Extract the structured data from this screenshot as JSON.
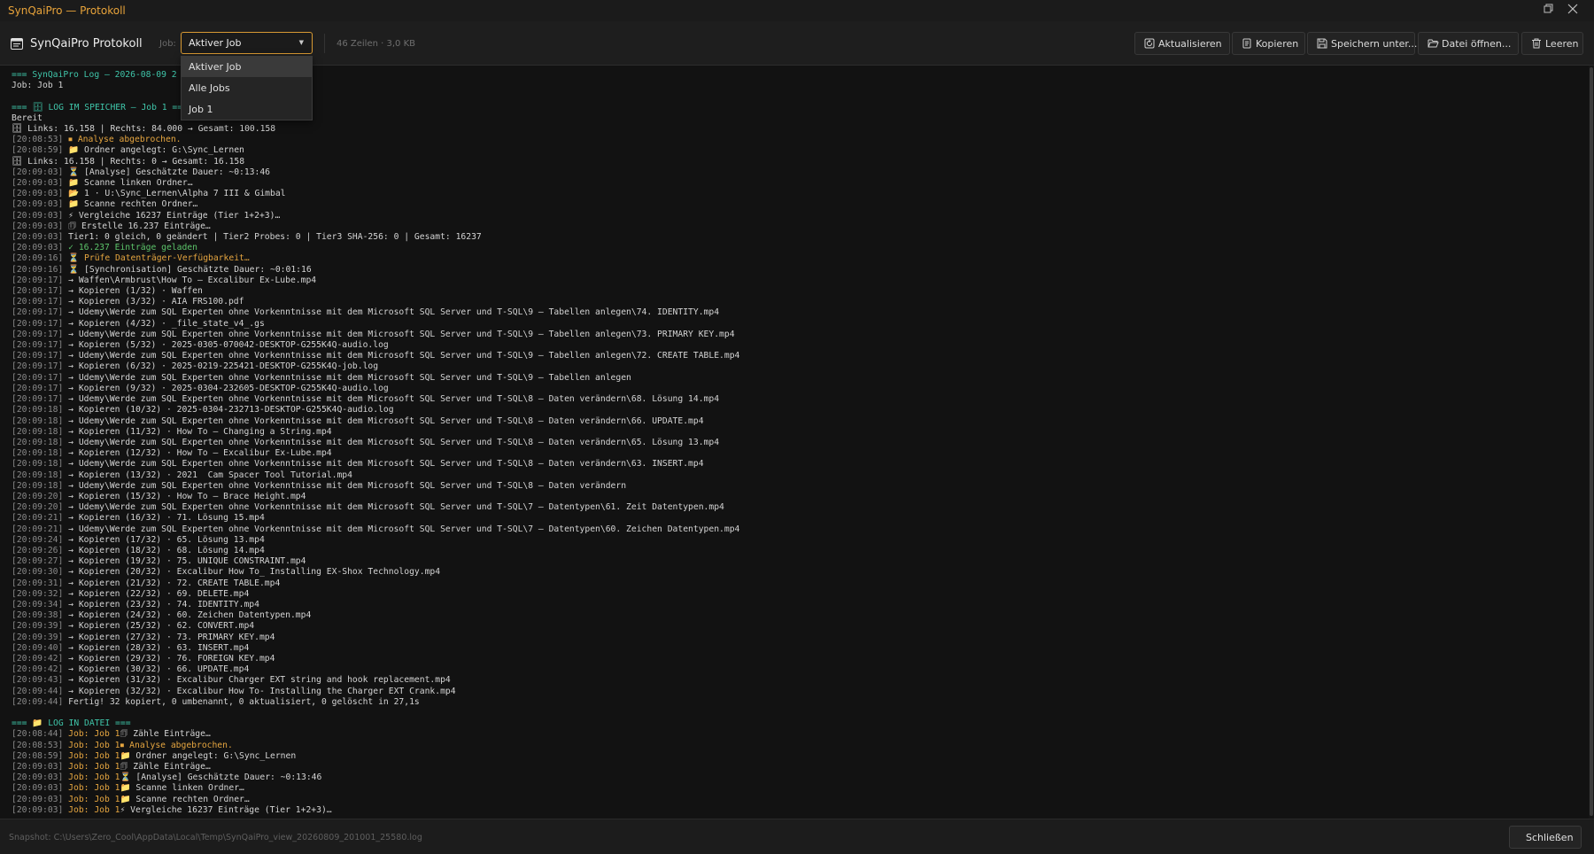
{
  "window": {
    "title": "SynQaiPro — Protokoll",
    "restore_icon": "restore-icon",
    "close_icon": "close-icon"
  },
  "toolbar": {
    "title": "SynQaiPro Protokoll",
    "job_label": "Job:",
    "job_selected": "Aktiver Job",
    "info": "46 Zeilen · 3,0 KB",
    "buttons": [
      {
        "label": "Aktualisieren",
        "icon": "refresh-icon"
      },
      {
        "label": "Kopieren",
        "icon": "copy-icon"
      },
      {
        "label": "Speichern unter...",
        "icon": "save-icon"
      },
      {
        "label": "Datei öffnen...",
        "icon": "folder-open-icon"
      },
      {
        "label": "Leeren",
        "icon": "trash-icon"
      }
    ]
  },
  "dropdown": {
    "options": [
      "Aktiver Job",
      "Alle Jobs",
      "Job 1"
    ],
    "selected_index": 0
  },
  "log": {
    "lines": [
      [
        [
          "=== SynQaiPro Log – 2026-08-09 2",
          "hd"
        ]
      ],
      [
        [
          "Job: Job 1",
          ""
        ]
      ],
      [
        [
          "",
          ""
        ]
      ],
      [
        [
          "=== 🗄 LOG IM SPEICHER – Job 1 ===",
          "hd"
        ]
      ],
      [
        [
          "Bereit",
          ""
        ]
      ],
      [
        [
          "🗄 Links: 16.158 | Rechts: 84.000 → Gesamt: 100.158",
          ""
        ]
      ],
      [
        [
          "[20:08:53] ",
          "ts"
        ],
        [
          "⏹ Analyse abgebrochen.",
          "wn"
        ]
      ],
      [
        [
          "[20:08:59] ",
          "ts"
        ],
        [
          "📁 Ordner angelegt: G:\\Sync_Lernen",
          ""
        ]
      ],
      [
        [
          "🗄 Links: 16.158 | Rechts: 0 → Gesamt: 16.158",
          ""
        ]
      ],
      [
        [
          "[20:09:03] ",
          "ts"
        ],
        [
          "⏳ [Analyse] Geschätzte Dauer: ~0:13:46",
          ""
        ]
      ],
      [
        [
          "[20:09:03] ",
          "ts"
        ],
        [
          "📁 Scanne linken Ordner…",
          ""
        ]
      ],
      [
        [
          "[20:09:03] ",
          "ts"
        ],
        [
          "📂 1 · U:\\Sync_Lernen\\Alpha 7 III & Gimbal",
          ""
        ]
      ],
      [
        [
          "[20:09:03] ",
          "ts"
        ],
        [
          "📁 Scanne rechten Ordner…",
          ""
        ]
      ],
      [
        [
          "[20:09:03] ",
          "ts"
        ],
        [
          "⚡ Vergleiche 16237 Einträge (Tier 1+2+3)…",
          ""
        ]
      ],
      [
        [
          "[20:09:03] ",
          "ts"
        ],
        [
          "🗊 Erstelle 16.237 Einträge…",
          ""
        ]
      ],
      [
        [
          "[20:09:03] ",
          "ts"
        ],
        [
          "Tier1: 0 gleich, 0 geändert | Tier2 Probes: 0 | Tier3 SHA-256: 0 | Gesamt: 16237",
          ""
        ]
      ],
      [
        [
          "[20:09:03] ",
          "ts"
        ],
        [
          "✓ 16.237 Einträge geladen",
          "ok"
        ]
      ],
      [
        [
          "[20:09:16] ",
          "ts"
        ],
        [
          "⏳ Prüfe Datenträger-Verfügbarkeit…",
          "wn"
        ]
      ],
      [
        [
          "[20:09:16] ",
          "ts"
        ],
        [
          "⏳ [Synchronisation] Geschätzte Dauer: ~0:01:16",
          ""
        ]
      ],
      [
        [
          "[20:09:17] ",
          "ts"
        ],
        [
          "→ Waffen\\Armbrust\\How To – Excalibur Ex-Lube.mp4",
          ""
        ]
      ],
      [
        [
          "[20:09:17] ",
          "ts"
        ],
        [
          "→ Kopieren (1/32) · Waffen",
          ""
        ]
      ],
      [
        [
          "[20:09:17] ",
          "ts"
        ],
        [
          "→ Kopieren (3/32) · AIA FRS100.pdf",
          ""
        ]
      ],
      [
        [
          "[20:09:17] ",
          "ts"
        ],
        [
          "→ Udemy\\Werde zum SQL Experten ohne Vorkenntnisse mit dem Microsoft SQL Server und T-SQL\\9 – Tabellen anlegen\\74. IDENTITY.mp4",
          ""
        ]
      ],
      [
        [
          "[20:09:17] ",
          "ts"
        ],
        [
          "→ Kopieren (4/32) · _file_state_v4_.gs",
          ""
        ]
      ],
      [
        [
          "[20:09:17] ",
          "ts"
        ],
        [
          "→ Udemy\\Werde zum SQL Experten ohne Vorkenntnisse mit dem Microsoft SQL Server und T-SQL\\9 – Tabellen anlegen\\73. PRIMARY KEY.mp4",
          ""
        ]
      ],
      [
        [
          "[20:09:17] ",
          "ts"
        ],
        [
          "→ Kopieren (5/32) · 2025-0305-070042-DESKTOP-G255K4Q-audio.log",
          ""
        ]
      ],
      [
        [
          "[20:09:17] ",
          "ts"
        ],
        [
          "→ Udemy\\Werde zum SQL Experten ohne Vorkenntnisse mit dem Microsoft SQL Server und T-SQL\\9 – Tabellen anlegen\\72. CREATE TABLE.mp4",
          ""
        ]
      ],
      [
        [
          "[20:09:17] ",
          "ts"
        ],
        [
          "→ Kopieren (6/32) · 2025-0219-225421-DESKTOP-G255K4Q-job.log",
          ""
        ]
      ],
      [
        [
          "[20:09:17] ",
          "ts"
        ],
        [
          "→ Udemy\\Werde zum SQL Experten ohne Vorkenntnisse mit dem Microsoft SQL Server und T-SQL\\9 – Tabellen anlegen",
          ""
        ]
      ],
      [
        [
          "[20:09:17] ",
          "ts"
        ],
        [
          "→ Kopieren (9/32) · 2025-0304-232605-DESKTOP-G255K4Q-audio.log",
          ""
        ]
      ],
      [
        [
          "[20:09:17] ",
          "ts"
        ],
        [
          "→ Udemy\\Werde zum SQL Experten ohne Vorkenntnisse mit dem Microsoft SQL Server und T-SQL\\8 – Daten verändern\\68. Lösung 14.mp4",
          ""
        ]
      ],
      [
        [
          "[20:09:18] ",
          "ts"
        ],
        [
          "→ Kopieren (10/32) · 2025-0304-232713-DESKTOP-G255K4Q-audio.log",
          ""
        ]
      ],
      [
        [
          "[20:09:18] ",
          "ts"
        ],
        [
          "→ Udemy\\Werde zum SQL Experten ohne Vorkenntnisse mit dem Microsoft SQL Server und T-SQL\\8 – Daten verändern\\66. UPDATE.mp4",
          ""
        ]
      ],
      [
        [
          "[20:09:18] ",
          "ts"
        ],
        [
          "→ Kopieren (11/32) · How To – Changing a String.mp4",
          ""
        ]
      ],
      [
        [
          "[20:09:18] ",
          "ts"
        ],
        [
          "→ Udemy\\Werde zum SQL Experten ohne Vorkenntnisse mit dem Microsoft SQL Server und T-SQL\\8 – Daten verändern\\65. Lösung 13.mp4",
          ""
        ]
      ],
      [
        [
          "[20:09:18] ",
          "ts"
        ],
        [
          "→ Kopieren (12/32) · How To – Excalibur Ex-Lube.mp4",
          ""
        ]
      ],
      [
        [
          "[20:09:18] ",
          "ts"
        ],
        [
          "→ Udemy\\Werde zum SQL Experten ohne Vorkenntnisse mit dem Microsoft SQL Server und T-SQL\\8 – Daten verändern\\63. INSERT.mp4",
          ""
        ]
      ],
      [
        [
          "[20:09:18] ",
          "ts"
        ],
        [
          "→ Kopieren (13/32) · 2021  Cam Spacer Tool Tutorial.mp4",
          ""
        ]
      ],
      [
        [
          "[20:09:18] ",
          "ts"
        ],
        [
          "→ Udemy\\Werde zum SQL Experten ohne Vorkenntnisse mit dem Microsoft SQL Server und T-SQL\\8 – Daten verändern",
          ""
        ]
      ],
      [
        [
          "[20:09:20] ",
          "ts"
        ],
        [
          "→ Kopieren (15/32) · How To – Brace Height.mp4",
          ""
        ]
      ],
      [
        [
          "[20:09:20] ",
          "ts"
        ],
        [
          "→ Udemy\\Werde zum SQL Experten ohne Vorkenntnisse mit dem Microsoft SQL Server und T-SQL\\7 – Datentypen\\61. Zeit Datentypen.mp4",
          ""
        ]
      ],
      [
        [
          "[20:09:21] ",
          "ts"
        ],
        [
          "→ Kopieren (16/32) · 71. Lösung 15.mp4",
          ""
        ]
      ],
      [
        [
          "[20:09:21] ",
          "ts"
        ],
        [
          "→ Udemy\\Werde zum SQL Experten ohne Vorkenntnisse mit dem Microsoft SQL Server und T-SQL\\7 – Datentypen\\60. Zeichen Datentypen.mp4",
          ""
        ]
      ],
      [
        [
          "[20:09:24] ",
          "ts"
        ],
        [
          "→ Kopieren (17/32) · 65. Lösung 13.mp4",
          ""
        ]
      ],
      [
        [
          "[20:09:26] ",
          "ts"
        ],
        [
          "→ Kopieren (18/32) · 68. Lösung 14.mp4",
          ""
        ]
      ],
      [
        [
          "[20:09:27] ",
          "ts"
        ],
        [
          "→ Kopieren (19/32) · 75. UNIQUE CONSTRAINT.mp4",
          ""
        ]
      ],
      [
        [
          "[20:09:30] ",
          "ts"
        ],
        [
          "→ Kopieren (20/32) · Excalibur How To_ Installing EX-Shox Technology.mp4",
          ""
        ]
      ],
      [
        [
          "[20:09:31] ",
          "ts"
        ],
        [
          "→ Kopieren (21/32) · 72. CREATE TABLE.mp4",
          ""
        ]
      ],
      [
        [
          "[20:09:32] ",
          "ts"
        ],
        [
          "→ Kopieren (22/32) · 69. DELETE.mp4",
          ""
        ]
      ],
      [
        [
          "[20:09:34] ",
          "ts"
        ],
        [
          "→ Kopieren (23/32) · 74. IDENTITY.mp4",
          ""
        ]
      ],
      [
        [
          "[20:09:38] ",
          "ts"
        ],
        [
          "→ Kopieren (24/32) · 60. Zeichen Datentypen.mp4",
          ""
        ]
      ],
      [
        [
          "[20:09:39] ",
          "ts"
        ],
        [
          "→ Kopieren (25/32) · 62. CONVERT.mp4",
          ""
        ]
      ],
      [
        [
          "[20:09:39] ",
          "ts"
        ],
        [
          "→ Kopieren (27/32) · 73. PRIMARY KEY.mp4",
          ""
        ]
      ],
      [
        [
          "[20:09:40] ",
          "ts"
        ],
        [
          "→ Kopieren (28/32) · 63. INSERT.mp4",
          ""
        ]
      ],
      [
        [
          "[20:09:42] ",
          "ts"
        ],
        [
          "→ Kopieren (29/32) · 76. FOREIGN KEY.mp4",
          ""
        ]
      ],
      [
        [
          "[20:09:42] ",
          "ts"
        ],
        [
          "→ Kopieren (30/32) · 66. UPDATE.mp4",
          ""
        ]
      ],
      [
        [
          "[20:09:43] ",
          "ts"
        ],
        [
          "→ Kopieren (31/32) · Excalibur Charger EXT string and hook replacement.mp4",
          ""
        ]
      ],
      [
        [
          "[20:09:44] ",
          "ts"
        ],
        [
          "→ Kopieren (32/32) · Excalibur How To- Installing the Charger EXT Crank.mp4",
          ""
        ]
      ],
      [
        [
          "[20:09:44] ",
          "ts"
        ],
        [
          "Fertig! 32 kopiert, 0 umbenannt, 0 aktualisiert, 0 gelöscht in 27,1s",
          ""
        ]
      ],
      [
        [
          "",
          ""
        ]
      ],
      [
        [
          "=== 📁 LOG IN DATEI ===",
          "hd"
        ]
      ],
      [
        [
          "[20:08:44] ",
          "ts"
        ],
        [
          "Job: Job 1",
          "jb"
        ],
        [
          "🗊 Zähle Einträge…",
          ""
        ]
      ],
      [
        [
          "[20:08:53] ",
          "ts"
        ],
        [
          "Job: Job 1",
          "jb"
        ],
        [
          "⏹ Analyse abgebrochen.",
          "wn"
        ]
      ],
      [
        [
          "[20:08:59] ",
          "ts"
        ],
        [
          "Job: Job 1",
          "jb"
        ],
        [
          "📁 Ordner angelegt: G:\\Sync_Lernen",
          ""
        ]
      ],
      [
        [
          "[20:09:03] ",
          "ts"
        ],
        [
          "Job: Job 1",
          "jb"
        ],
        [
          "🗊 Zähle Einträge…",
          ""
        ]
      ],
      [
        [
          "[20:09:03] ",
          "ts"
        ],
        [
          "Job: Job 1",
          "jb"
        ],
        [
          "⏳ [Analyse] Geschätzte Dauer: ~0:13:46",
          ""
        ]
      ],
      [
        [
          "[20:09:03] ",
          "ts"
        ],
        [
          "Job: Job 1",
          "jb"
        ],
        [
          "📁 Scanne linken Ordner…",
          ""
        ]
      ],
      [
        [
          "[20:09:03] ",
          "ts"
        ],
        [
          "Job: Job 1",
          "jb"
        ],
        [
          "📁 Scanne rechten Ordner…",
          ""
        ]
      ],
      [
        [
          "[20:09:03] ",
          "ts"
        ],
        [
          "Job: Job 1",
          "jb"
        ],
        [
          "⚡ Vergleiche 16237 Einträge (Tier 1+2+3)…",
          ""
        ]
      ]
    ]
  },
  "status": {
    "snapshot": "Snapshot: C:\\Users\\Zero_Cool\\AppData\\Local\\Temp\\SynQaiPro_view_20260809_201001_25580.log",
    "close_label": "Schließen"
  },
  "colors": {
    "accent": "#e8a33a",
    "header": "#3fc5a9",
    "success": "#5cc46a",
    "background": "#121212"
  }
}
